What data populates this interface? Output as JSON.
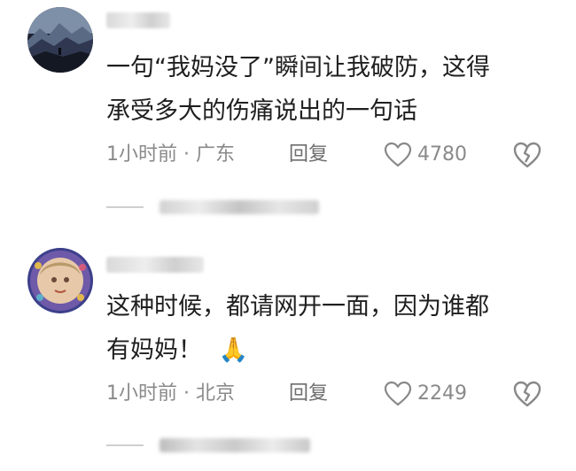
{
  "comments": [
    {
      "text_line1": "一句“我妈没了”瞬间让我破防，这得",
      "text_line2": "承受多大的伤痛说出的一句话",
      "time": "1小时前 · 广东",
      "reply_label": "回复",
      "likes": "4780",
      "avatar_icon": "mountain-landscape-avatar",
      "like_icon": "heart-outline-icon",
      "dislike_icon": "broken-heart-icon"
    },
    {
      "text_line1": "这种时候，都请网开一面，因为谁都",
      "text_line2": "有妈妈！",
      "emoji": "🙏",
      "time": "1小时前 · 北京",
      "reply_label": "回复",
      "likes": "2249",
      "avatar_icon": "illustrated-portrait-avatar",
      "like_icon": "heart-outline-icon",
      "dislike_icon": "broken-heart-icon"
    }
  ],
  "colors": {
    "text": "#1f1f1f",
    "meta": "#8a8a8a",
    "icon": "#888888"
  }
}
